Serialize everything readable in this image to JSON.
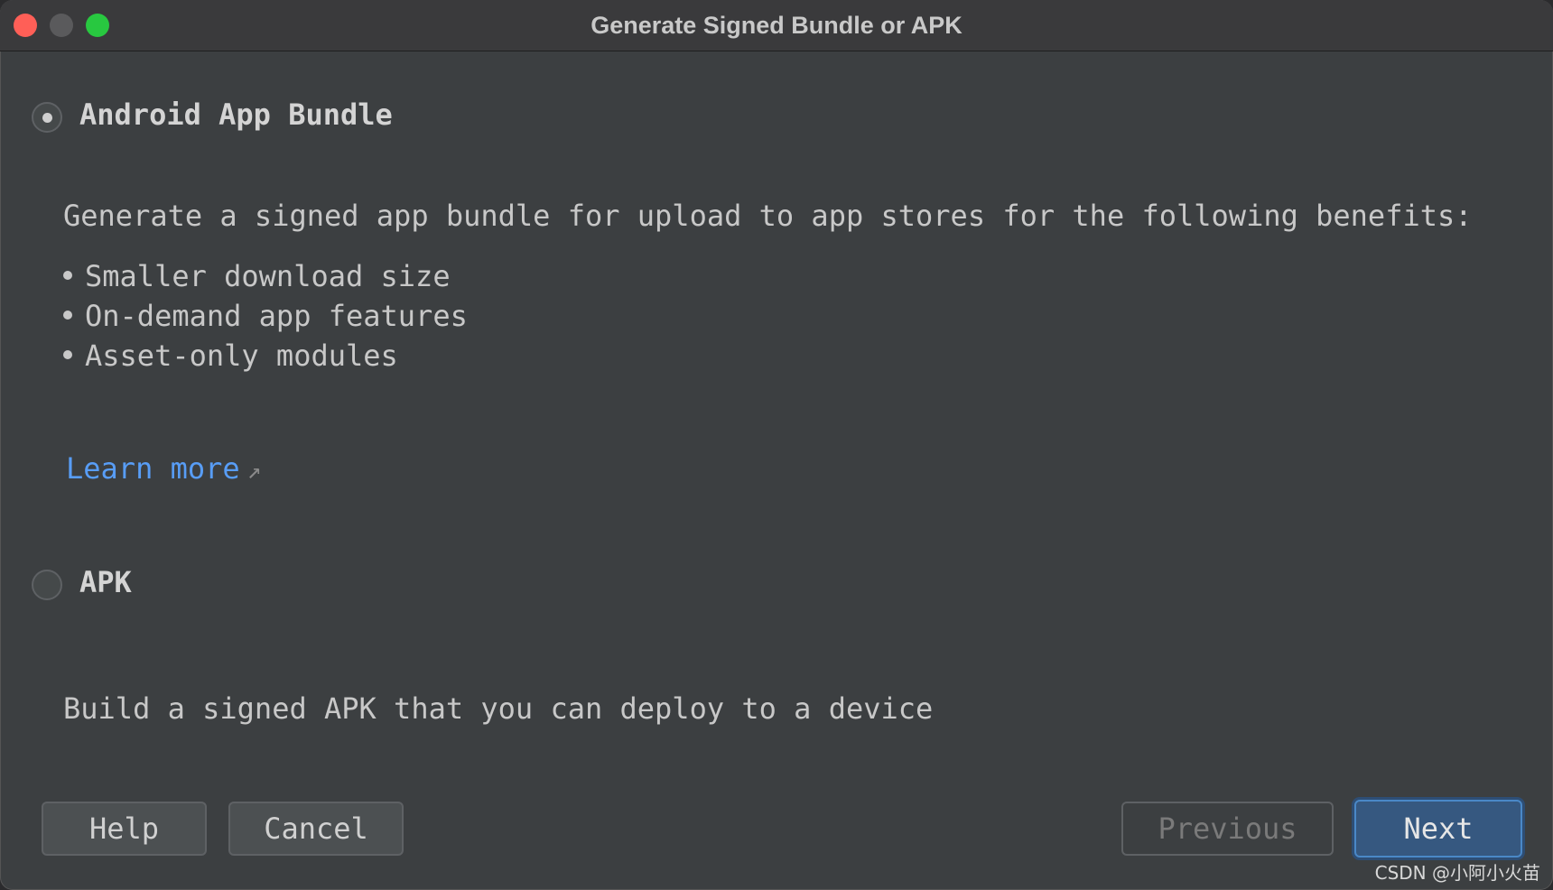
{
  "window": {
    "title": "Generate Signed Bundle or APK"
  },
  "options": {
    "bundle": {
      "label": "Android App Bundle",
      "selected": true,
      "description": "Generate a signed app bundle for upload to app stores for the following benefits:",
      "benefits": [
        "Smaller download size",
        "On-demand app features",
        "Asset-only modules"
      ],
      "link_label": "Learn more",
      "link_icon": "external-link-icon"
    },
    "apk": {
      "label": "APK",
      "selected": false,
      "description": "Build a signed APK that you can deploy to a device"
    }
  },
  "buttons": {
    "help": "Help",
    "cancel": "Cancel",
    "previous": "Previous",
    "next": "Next"
  },
  "watermark": "CSDN @小阿小火苗",
  "colors": {
    "background": "#3c3f41",
    "link": "#589df6",
    "primary_button": "#365880",
    "close": "#ff5f57",
    "zoom": "#28c840"
  }
}
